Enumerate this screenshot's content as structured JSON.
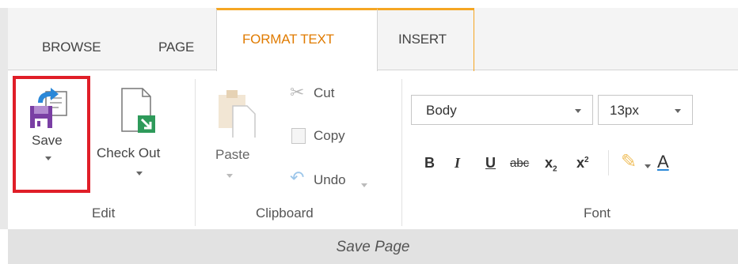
{
  "tabs": {
    "browse": "BROWSE",
    "page": "PAGE",
    "format_text": "FORMAT TEXT",
    "insert": "INSERT"
  },
  "edit_group": {
    "label": "Edit",
    "save_label": "Save",
    "checkout_label": "Check Out"
  },
  "clipboard_group": {
    "label": "Clipboard",
    "paste_label": "Paste",
    "cut_label": "Cut",
    "copy_label": "Copy",
    "undo_label": "Undo"
  },
  "font_group": {
    "label": "Font",
    "style_value": "Body",
    "size_value": "13px",
    "bold": "B",
    "italic": "I",
    "underline": "U",
    "strikethrough": "abc",
    "subscript": "x",
    "subscript_mark": "2",
    "superscript": "x",
    "superscript_mark": "2",
    "font_color": "A"
  },
  "footer": {
    "caption": "Save Page"
  },
  "colors": {
    "accent_tab": "#f5a623",
    "active_tab_text": "#e07b00",
    "highlight": "#e01e28",
    "footer_bg": "#e2e2e2"
  }
}
